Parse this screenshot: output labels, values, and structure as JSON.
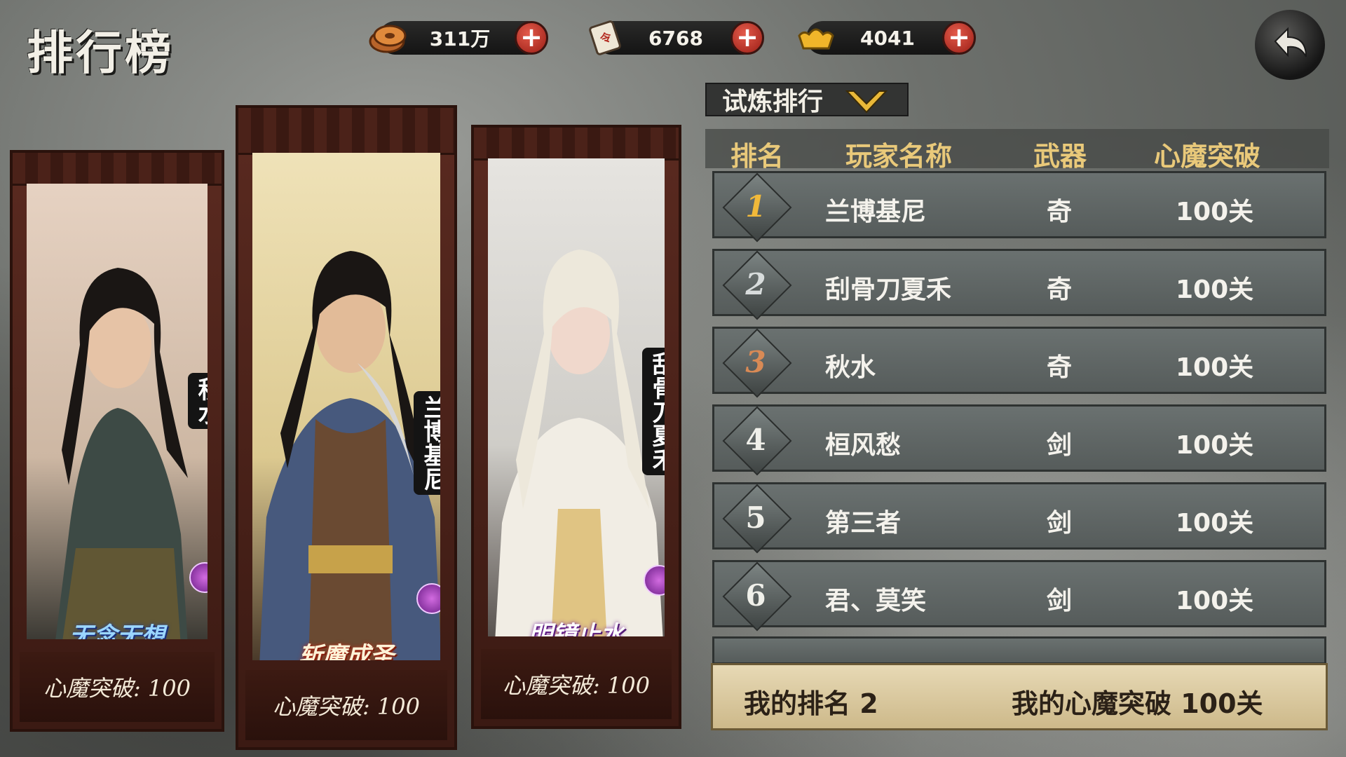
{
  "page_title": "排行榜",
  "resources": [
    {
      "name": "coins",
      "icon": "copper-coin-icon",
      "value": "311万"
    },
    {
      "name": "tickets",
      "icon": "scroll-ticket-icon",
      "value": "6768"
    },
    {
      "name": "ingots",
      "icon": "gold-ingot-icon",
      "value": "4041"
    }
  ],
  "top3": [
    {
      "name": "秋水",
      "title": "无念无想",
      "score": "心魔突破: 100"
    },
    {
      "name": "兰博基尼",
      "title": "斩魔成圣",
      "score": "心魔突破: 100"
    },
    {
      "name": "刮骨刀夏禾",
      "title": "明镜止水",
      "score": "心魔突破: 100"
    }
  ],
  "ranking_type": "试炼排行",
  "headers": {
    "rank": "排名",
    "name": "玩家名称",
    "weapon": "武器",
    "progress": "心魔突破"
  },
  "rows": [
    {
      "rank": "1",
      "name": "兰博基尼",
      "weapon": "奇",
      "progress": "100关"
    },
    {
      "rank": "2",
      "name": "刮骨刀夏禾",
      "weapon": "奇",
      "progress": "100关"
    },
    {
      "rank": "3",
      "name": "秋水",
      "weapon": "奇",
      "progress": "100关"
    },
    {
      "rank": "4",
      "name": "桓风愁",
      "weapon": "剑",
      "progress": "100关"
    },
    {
      "rank": "5",
      "name": "第三者",
      "weapon": "剑",
      "progress": "100关"
    },
    {
      "rank": "6",
      "name": "君、莫笑",
      "weapon": "剑",
      "progress": "100关"
    }
  ],
  "my_rank": "我的排名 2",
  "my_progress": "我的心魔突破 100关",
  "colors": {
    "gold_rank": "#f1b93a",
    "silver_rank": "#d8dcdc",
    "bronze_rank": "#d98a55",
    "header_text": "#e9c97a"
  }
}
